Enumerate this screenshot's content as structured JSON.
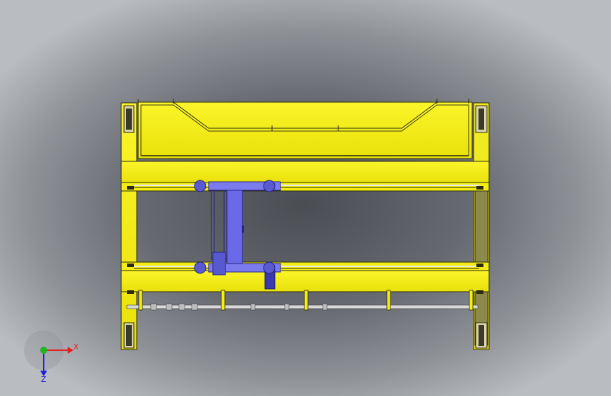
{
  "viewport": {
    "background_center": "#4a4d52",
    "background_edge": "#b9bcc0"
  },
  "colors": {
    "frame_yellow": "#f5ef0e",
    "frame_outline": "#2b2a10",
    "end_truck_shade": "#8c8a4a",
    "trolley_blue": "#6a6ae8",
    "trolley_dark": "#24248a",
    "rail": "#e8e8e8"
  },
  "model": {
    "parts": [
      "upper-girder",
      "main-beam-top",
      "main-beam-bottom",
      "left-end-truck",
      "right-end-truck",
      "hoist-trolley",
      "drive-shaft",
      "wheel-assemblies"
    ]
  },
  "annotations": [
    {
      "id": "tick-top-left-1",
      "text": ""
    },
    {
      "id": "tick-top-left-2",
      "text": ""
    },
    {
      "id": "tick-bottom-left",
      "text": ""
    },
    {
      "id": "tick-bottom-right",
      "text": ""
    }
  ],
  "triad": {
    "x_label": "X",
    "z_label": "Z",
    "x_color": "#e32020",
    "y_color": "#22b422",
    "z_color": "#2020d8"
  }
}
